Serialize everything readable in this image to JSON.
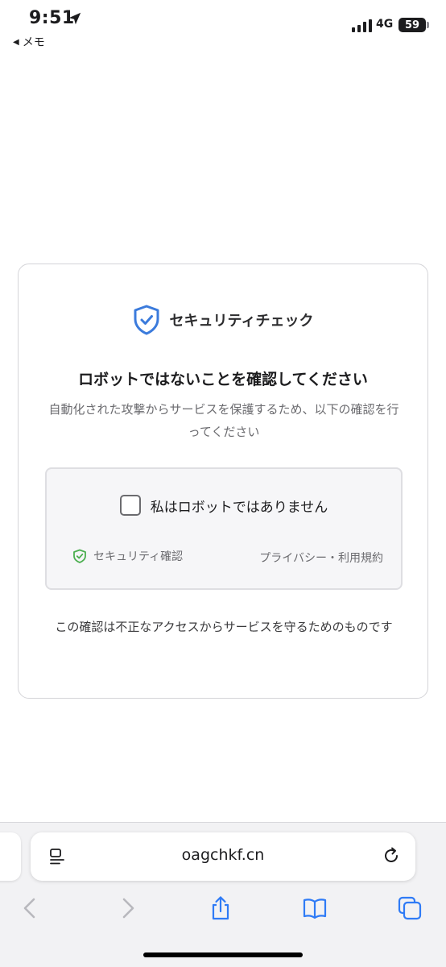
{
  "status_bar": {
    "time": "9:51",
    "back_app": "メモ",
    "network": "4G",
    "battery": "59"
  },
  "card": {
    "brand": "セキュリティチェック",
    "title": "ロボットではないことを確認してください",
    "description": "自動化された攻撃からサービスを保護するため、以下の確認を行ってください",
    "checkbox_label": "私はロボットではありません",
    "secure_label": "セキュリティ確認",
    "privacy_link": "プライバシー・利用規約",
    "footer": "この確認は不正なアクセスからサービスを守るためのものです"
  },
  "browser": {
    "url": "oagchkf.cn"
  },
  "colors": {
    "shield": "#3b7bdc",
    "secure_check": "#4caf50",
    "toolbar_icon": "#2f7bf6",
    "toolbar_disabled": "#b8b8bd"
  }
}
